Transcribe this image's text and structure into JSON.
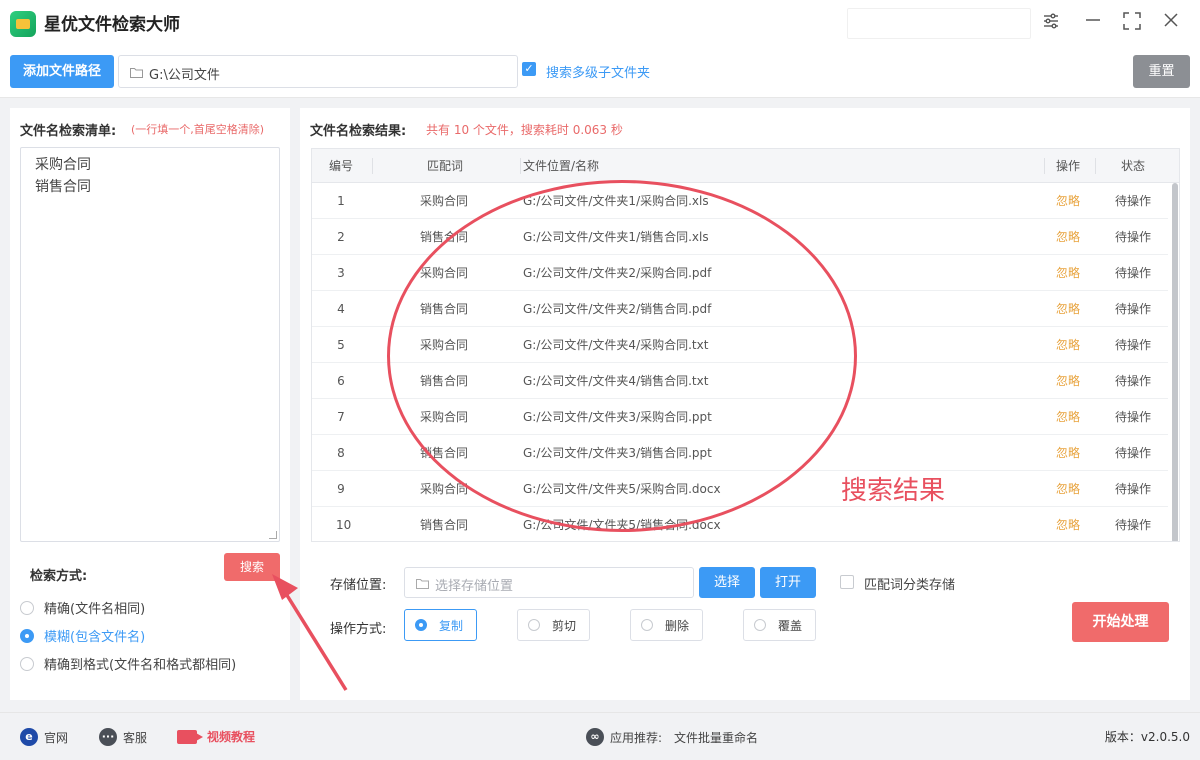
{
  "app": {
    "title": "星优文件检索大师"
  },
  "toolbar": {
    "add_path_label": "添加文件路径",
    "path_value": "G:\\公司文件",
    "subfolder_checked": true,
    "subfolder_label": "搜索多级子文件夹",
    "reset_label": "重置"
  },
  "left": {
    "list_label": "文件名检索清单:",
    "list_hint": "(一行填一个,首尾空格清除)",
    "names": [
      "采购合同",
      "销售合同"
    ],
    "mode_label": "检索方式:",
    "search_label": "搜索",
    "modes": [
      {
        "label": "精确(文件名相同)",
        "checked": false
      },
      {
        "label": "模糊(包含文件名)",
        "checked": true
      },
      {
        "label": "精确到格式(文件名和格式都相同)",
        "checked": false
      }
    ]
  },
  "results": {
    "label": "文件名检索结果:",
    "summary": "共有 10 个文件，搜索耗时 0.063 秒",
    "columns": [
      "编号",
      "匹配词",
      "文件位置/名称",
      "操作",
      "状态"
    ],
    "rows": [
      {
        "no": "1",
        "match": "采购合同",
        "path": "G:/公司文件/文件夹1/采购合同.xls",
        "action": "忽略",
        "status": "待操作"
      },
      {
        "no": "2",
        "match": "销售合同",
        "path": "G:/公司文件/文件夹1/销售合同.xls",
        "action": "忽略",
        "status": "待操作"
      },
      {
        "no": "3",
        "match": "采购合同",
        "path": "G:/公司文件/文件夹2/采购合同.pdf",
        "action": "忽略",
        "status": "待操作"
      },
      {
        "no": "4",
        "match": "销售合同",
        "path": "G:/公司文件/文件夹2/销售合同.pdf",
        "action": "忽略",
        "status": "待操作"
      },
      {
        "no": "5",
        "match": "采购合同",
        "path": "G:/公司文件/文件夹4/采购合同.txt",
        "action": "忽略",
        "status": "待操作"
      },
      {
        "no": "6",
        "match": "销售合同",
        "path": "G:/公司文件/文件夹4/销售合同.txt",
        "action": "忽略",
        "status": "待操作"
      },
      {
        "no": "7",
        "match": "采购合同",
        "path": "G:/公司文件/文件夹3/采购合同.ppt",
        "action": "忽略",
        "status": "待操作"
      },
      {
        "no": "8",
        "match": "销售合同",
        "path": "G:/公司文件/文件夹3/销售合同.ppt",
        "action": "忽略",
        "status": "待操作"
      },
      {
        "no": "9",
        "match": "采购合同",
        "path": "G:/公司文件/文件夹5/采购合同.docx",
        "action": "忽略",
        "status": "待操作"
      },
      {
        "no": "10",
        "match": "销售合同",
        "path": "G:/公司文件/文件夹5/销售合同.docx",
        "action": "忽略",
        "status": "待操作"
      }
    ],
    "annotation": "搜索结果"
  },
  "storage": {
    "label": "存储位置:",
    "placeholder": "选择存储位置",
    "choose_label": "选择",
    "open_label": "打开",
    "category_checked": false,
    "category_label": "匹配词分类存储"
  },
  "operation": {
    "label": "操作方式:",
    "options": [
      {
        "label": "复制",
        "checked": true
      },
      {
        "label": "剪切",
        "checked": false
      },
      {
        "label": "删除",
        "checked": false
      },
      {
        "label": "覆盖",
        "checked": false
      }
    ],
    "start_label": "开始处理"
  },
  "footer": {
    "website_label": "官网",
    "service_label": "客服",
    "video_label": "视频教程",
    "recommend_label": "应用推荐:",
    "recommend_value": "文件批量重命名",
    "version": "版本：v2.0.5.0"
  },
  "colors": {
    "accent": "#3c9af5",
    "danger": "#f06b6b",
    "warning": "#e8a33d",
    "annotation": "#e8505f"
  }
}
